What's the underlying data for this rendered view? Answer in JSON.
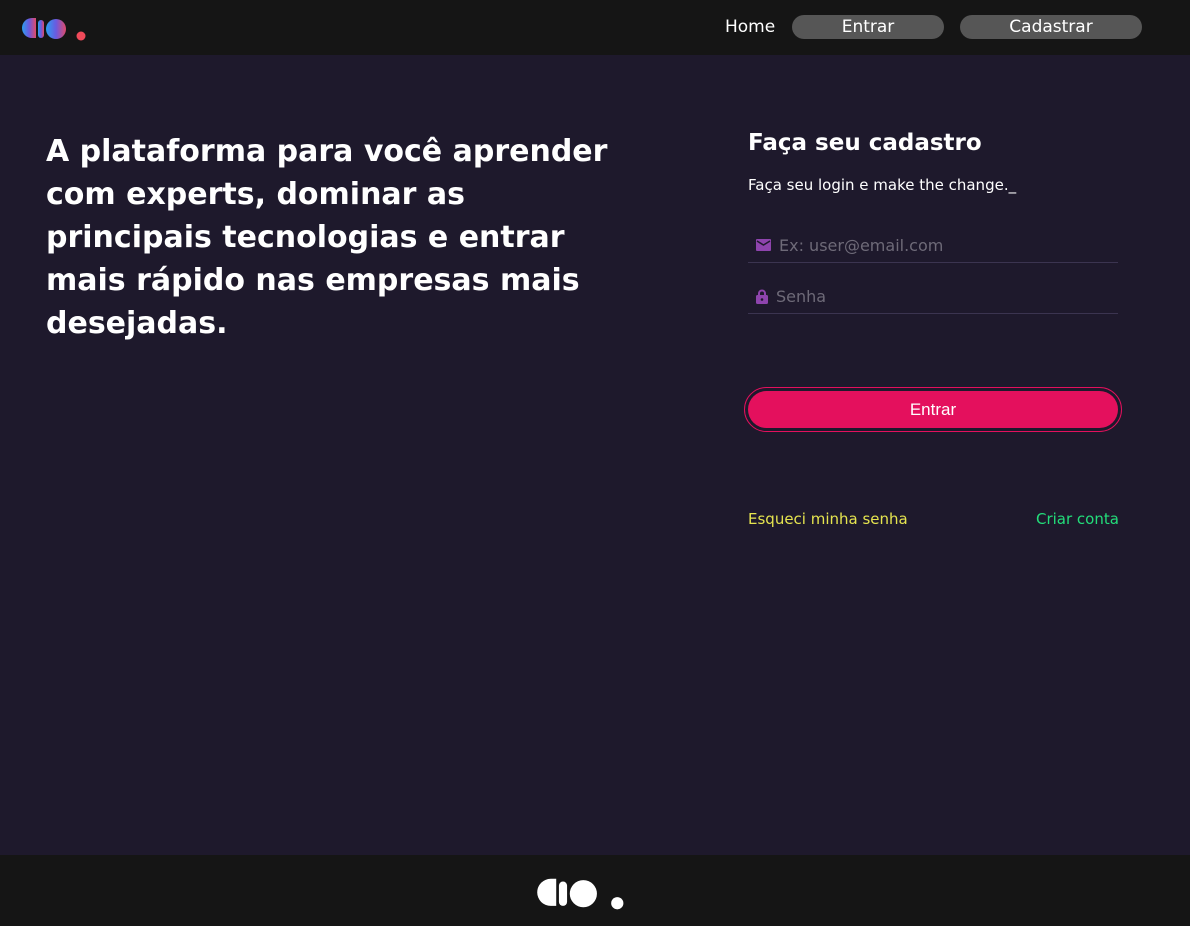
{
  "header": {
    "nav": {
      "home": "Home",
      "login": "Entrar",
      "signup": "Cadastrar"
    }
  },
  "hero": {
    "title": "A plataforma para você aprender com experts, dominar as principais tecnologias e entrar mais rápido nas empresas mais desejadas."
  },
  "form": {
    "title": "Faça seu cadastro",
    "subtitle": "Faça seu login e make the change._",
    "email_placeholder": "Ex: user@email.com",
    "password_placeholder": "Senha",
    "submit": "Entrar",
    "forgot": "Esqueci minha senha",
    "create": "Criar conta"
  },
  "colors": {
    "accent": "#e4105d",
    "forgot": "#e5e44f",
    "create": "#23dd7a",
    "icon": "#8e44ad"
  }
}
